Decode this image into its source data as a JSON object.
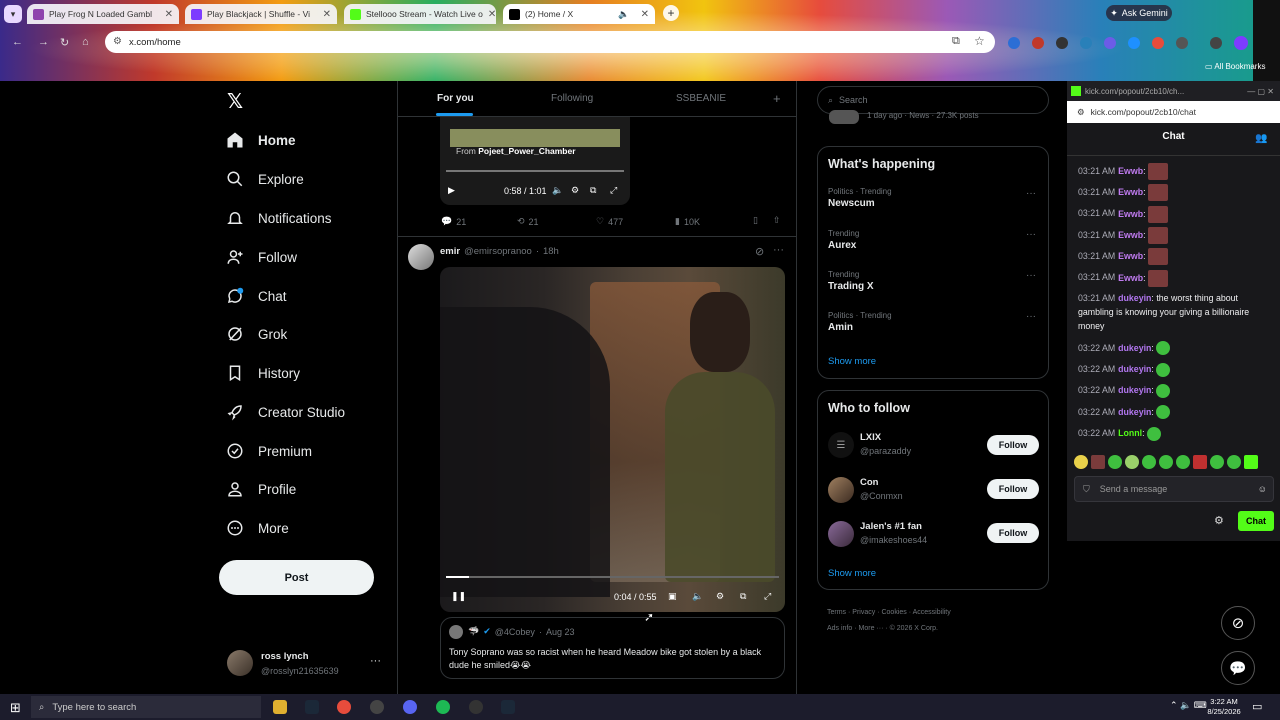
{
  "browser": {
    "tabs": [
      {
        "title": "Play Frog N Loaded Gambl",
        "fav_color": "#8e44ad"
      },
      {
        "title": "Play Blackjack | Shuffle - Vi",
        "fav_color": "#7d3cff"
      },
      {
        "title": "Stellooo Stream - Watch Live o",
        "fav_color": "#53fc18"
      },
      {
        "title": "(2) Home / X",
        "fav_color": "#000000"
      }
    ],
    "url": "x.com/home",
    "ask_gemini": "Ask Gemini",
    "bookmarks_label": "All Bookmarks"
  },
  "sidebar": {
    "items": [
      {
        "label": "Home",
        "icon": "home-icon"
      },
      {
        "label": "Explore",
        "icon": "search-icon"
      },
      {
        "label": "Notifications",
        "icon": "bell-icon"
      },
      {
        "label": "Follow",
        "icon": "add-person-icon"
      },
      {
        "label": "Chat",
        "icon": "chat-icon"
      },
      {
        "label": "Grok",
        "icon": "grok-icon"
      },
      {
        "label": "History",
        "icon": "bookmark-icon"
      },
      {
        "label": "Creator Studio",
        "icon": "rocket-icon"
      },
      {
        "label": "Premium",
        "icon": "verified-icon"
      },
      {
        "label": "Profile",
        "icon": "person-icon"
      },
      {
        "label": "More",
        "icon": "more-circle-icon"
      }
    ],
    "post_label": "Post",
    "account": {
      "name": "ross lynch",
      "handle": "@rosslyn21635639"
    }
  },
  "feed": {
    "tabs": [
      "For you",
      "Following",
      "SSBEANIE"
    ],
    "prev_post": {
      "quote_from": "From",
      "quote_source": "Pojeet_Power_Chamber",
      "time": "0:58 / 1:01",
      "replies": "21",
      "reposts": "21",
      "likes": "477",
      "views": "10K"
    },
    "post": {
      "name": "emir",
      "handle": "@emirsopranoo",
      "age": "18h",
      "video_time": "0:04 / 0:55",
      "progress": 0.07,
      "quote_handle": "@4Cobey",
      "quote_date": "Aug 23",
      "quote_text": "Tony Soprano was so racist when he heard Meadow bike got stolen by a black dude he smiled😭😭"
    }
  },
  "right": {
    "search_placeholder": "Search",
    "top_snippet": "1 day ago · News · 27.3K posts",
    "happening_title": "What's happening",
    "trends": [
      {
        "category": "Politics · Trending",
        "name": "Newscum"
      },
      {
        "category": "Trending",
        "name": "Aurex"
      },
      {
        "category": "Trending",
        "name": "Trading X"
      },
      {
        "category": "Politics · Trending",
        "name": "Amin"
      }
    ],
    "show_more": "Show more",
    "who_title": "Who to follow",
    "follow_suggestions": [
      {
        "name": "LXIX",
        "handle": "@parazaddy"
      },
      {
        "name": "Con",
        "handle": "@Conmxn"
      },
      {
        "name": "Jalen's #1 fan",
        "handle": "@imakeshoes44"
      }
    ],
    "follow_label": "Follow",
    "footer_links": [
      "Terms",
      "Privacy",
      "Cookies",
      "Accessibility",
      "Ads info",
      "More ···",
      "© 2026 X Corp."
    ]
  },
  "chat_popup": {
    "url": "kick.com/popout/2cb10/chat",
    "url_title": "kick.com/popout/2cb10/ch...",
    "title": "Chat",
    "messages": [
      {
        "time": "03:21 AM",
        "user": "Ewwb",
        "text": "",
        "emote": "red"
      },
      {
        "time": "03:21 AM",
        "user": "Ewwb",
        "text": "",
        "emote": "red"
      },
      {
        "time": "03:21 AM",
        "user": "Ewwb",
        "text": "",
        "emote": "red"
      },
      {
        "time": "03:21 AM",
        "user": "Ewwb",
        "text": "",
        "emote": "red"
      },
      {
        "time": "03:21 AM",
        "user": "Ewwb",
        "text": "",
        "emote": "red"
      },
      {
        "time": "03:21 AM",
        "user": "Ewwb",
        "text": "",
        "emote": "red"
      },
      {
        "time": "03:21 AM",
        "user": "dukeyin",
        "text": "the worst thing about gambling is knowing your giving a billionaire money",
        "emote": ""
      },
      {
        "time": "03:22 AM",
        "user": "dukeyin",
        "text": "",
        "emote": "green"
      },
      {
        "time": "03:22 AM",
        "user": "dukeyin",
        "text": "",
        "emote": "green"
      },
      {
        "time": "03:22 AM",
        "user": "dukeyin",
        "text": "",
        "emote": "green"
      },
      {
        "time": "03:22 AM",
        "user": "dukeyin",
        "text": "",
        "emote": "green"
      },
      {
        "time": "03:22 AM",
        "user": "Lonnl",
        "text": "",
        "emote": "green"
      }
    ],
    "input_placeholder": "Send a message",
    "send_label": "Chat"
  },
  "taskbar": {
    "search_placeholder": "Type here to search",
    "time": "3:22 AM",
    "date": "8/25/2026"
  },
  "colors": {
    "accent": "#1d9bf0",
    "kick_green": "#53fc18",
    "x_bg": "#000000"
  }
}
